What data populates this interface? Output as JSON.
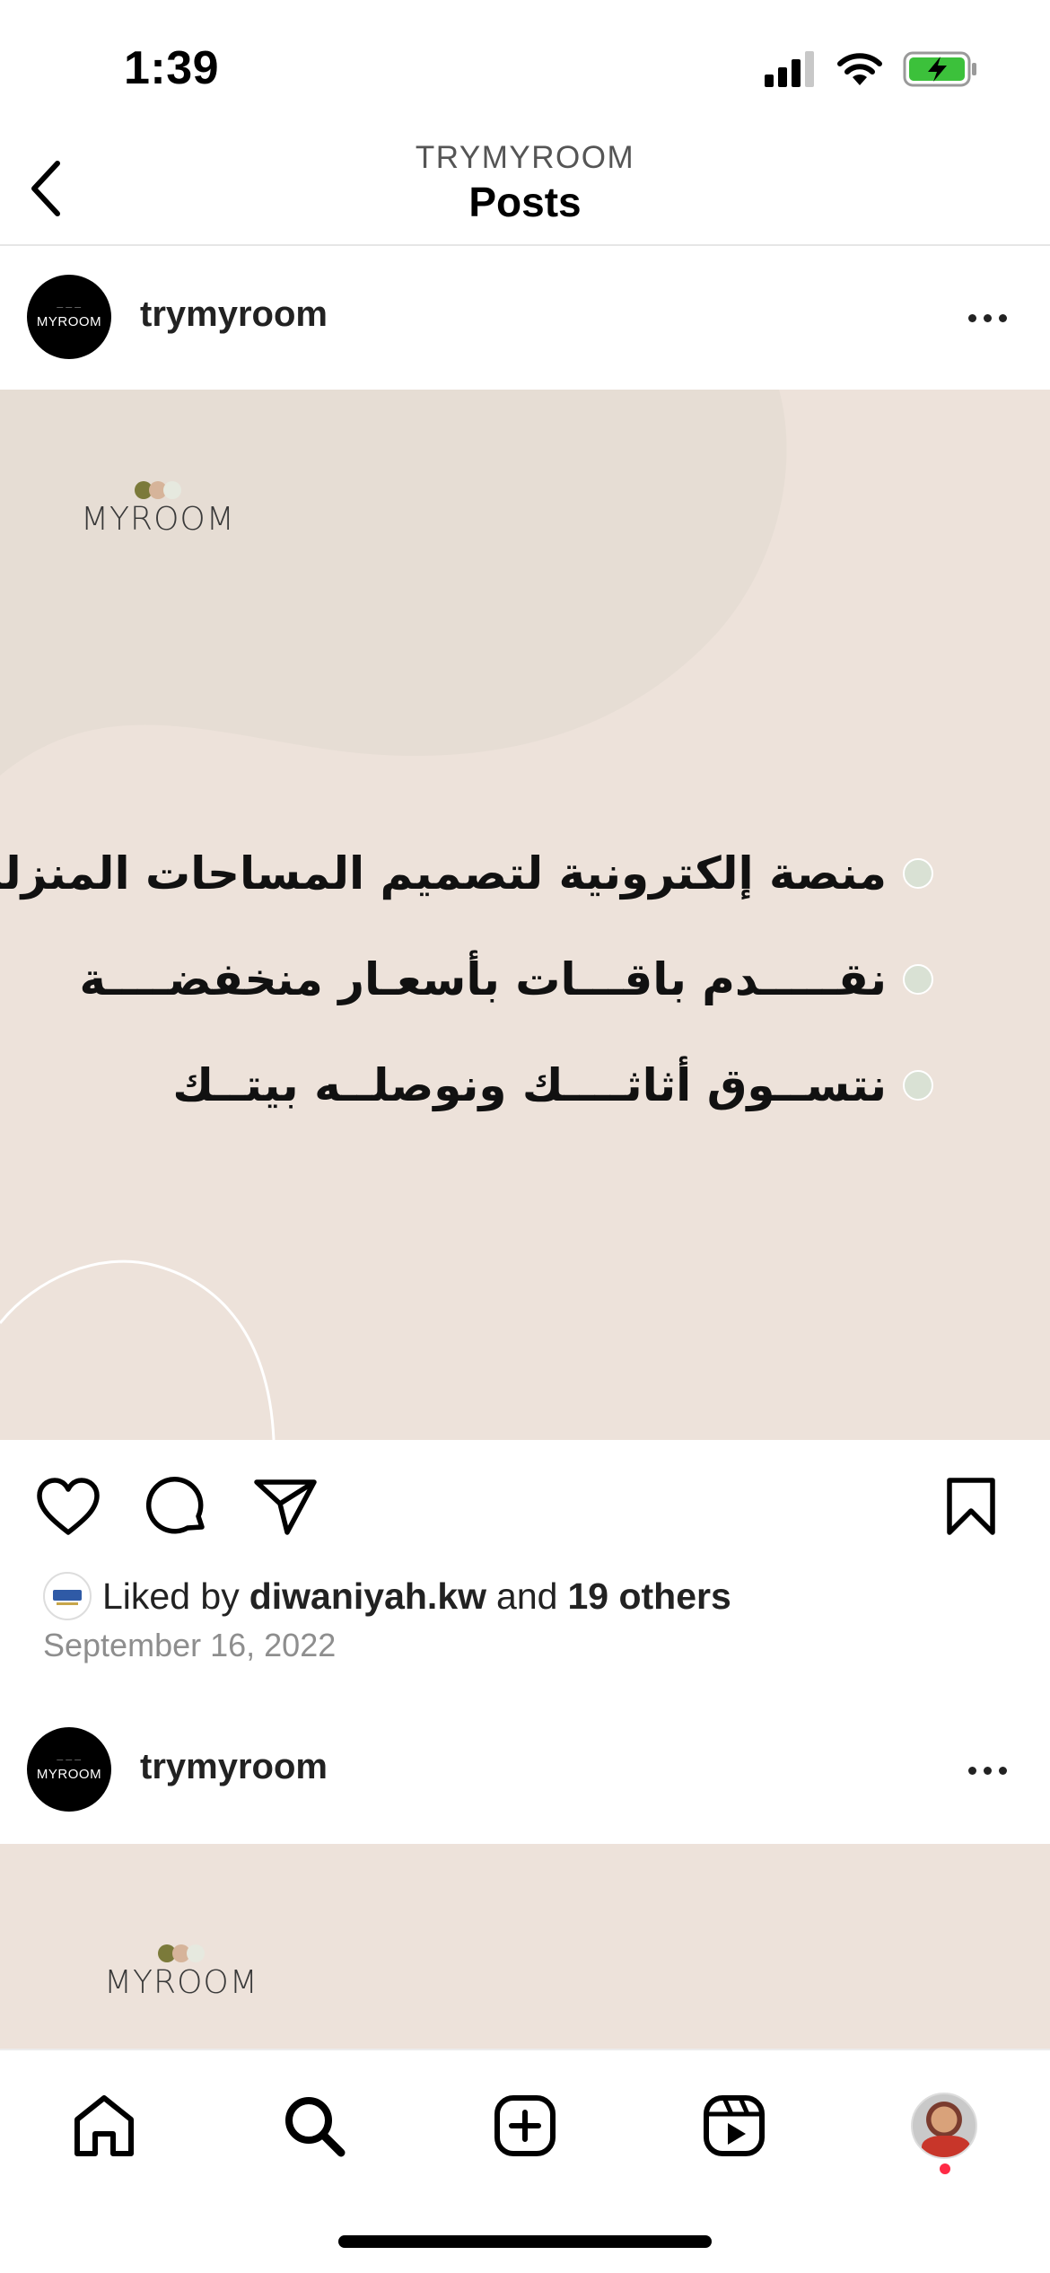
{
  "status_bar": {
    "time": "1:39"
  },
  "header": {
    "subtitle": "TRYMYROOM",
    "title": "Posts"
  },
  "posts": [
    {
      "username": "trymyroom",
      "avatar_text": "MYROOM",
      "image": {
        "logo_text": "MYROOM",
        "bullets": [
          "منصة إلكترونية لتصميم المساحات المنزلية",
          "نقـــــدم باقـــات بأسعـار منخفضــــة",
          "نتســوق أثاثــــك  ونوصلــه بيتــك"
        ],
        "colors": {
          "background": "#ede2da",
          "blob": "#e6ddd4",
          "dot": "#d9e1d4"
        }
      },
      "likes": {
        "prefix": "Liked by",
        "user": "diwaniyah.kw",
        "middle": "and",
        "others": "19 others"
      },
      "date": "September 16, 2022"
    },
    {
      "username": "trymyroom",
      "avatar_text": "MYROOM",
      "image": {
        "logo_text": "MYROOM"
      }
    }
  ],
  "nav": {
    "items": [
      "home-icon",
      "search-icon",
      "create-icon",
      "reels-icon",
      "profile-avatar"
    ]
  }
}
